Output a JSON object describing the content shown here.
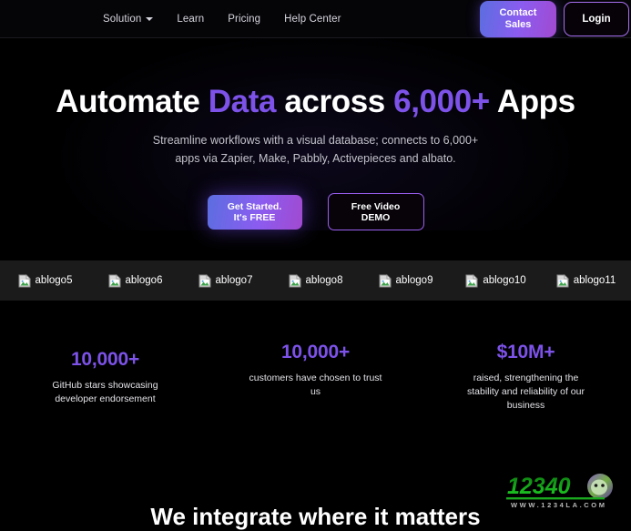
{
  "nav": {
    "links": [
      {
        "label": "Solution",
        "has_dropdown": true,
        "icon": "chevron-down-icon"
      },
      {
        "label": "Learn",
        "has_dropdown": false
      },
      {
        "label": "Pricing",
        "has_dropdown": false
      },
      {
        "label": "Help Center",
        "has_dropdown": false
      }
    ],
    "contact_sales_line1": "Contact",
    "contact_sales_line2": "Sales",
    "login_label": "Login"
  },
  "hero": {
    "headline_part1": "Automate ",
    "headline_accent1": "Data",
    "headline_part2": " across ",
    "headline_accent2": "6,000+",
    "headline_part3": " Apps",
    "subhead_line1": "Streamline workflows with a visual database; connects to 6,000+",
    "subhead_line2": "apps via Zapier, Make, Pabbly, Activepieces and albato.",
    "cta_primary_line1": "Get Started.",
    "cta_primary_line2": "It's FREE",
    "cta_secondary_line1": "Free Video",
    "cta_secondary_line2": "DEMO"
  },
  "logo_strip": {
    "icon": "broken-image-icon",
    "items": [
      {
        "alt": "ablogo5"
      },
      {
        "alt": "ablogo6"
      },
      {
        "alt": "ablogo7"
      },
      {
        "alt": "ablogo8"
      },
      {
        "alt": "ablogo9"
      },
      {
        "alt": "ablogo10"
      },
      {
        "alt": "ablogo11"
      }
    ]
  },
  "stats": [
    {
      "value": "10,000+",
      "description": "GitHub stars showcasing developer endorsement"
    },
    {
      "value": "10,000+",
      "description": "customers have chosen to trust us"
    },
    {
      "value": "$10M+",
      "description": "raised, strengthening the stability and reliability of our business"
    }
  ],
  "bottom_section": {
    "heading": "We integrate where it matters"
  },
  "watermark": {
    "digits": "12340",
    "url": "W W W . 1 2 3 4 L A . C O M"
  },
  "colors": {
    "background": "#000000",
    "accent_purple": "#7c52e8",
    "gradient_start": "#5b6ee0",
    "gradient_end": "#a14ad0",
    "button_border": "#a86ff0",
    "logo_strip_bg": "#1b1b1b",
    "watermark_green": "#14a018"
  }
}
